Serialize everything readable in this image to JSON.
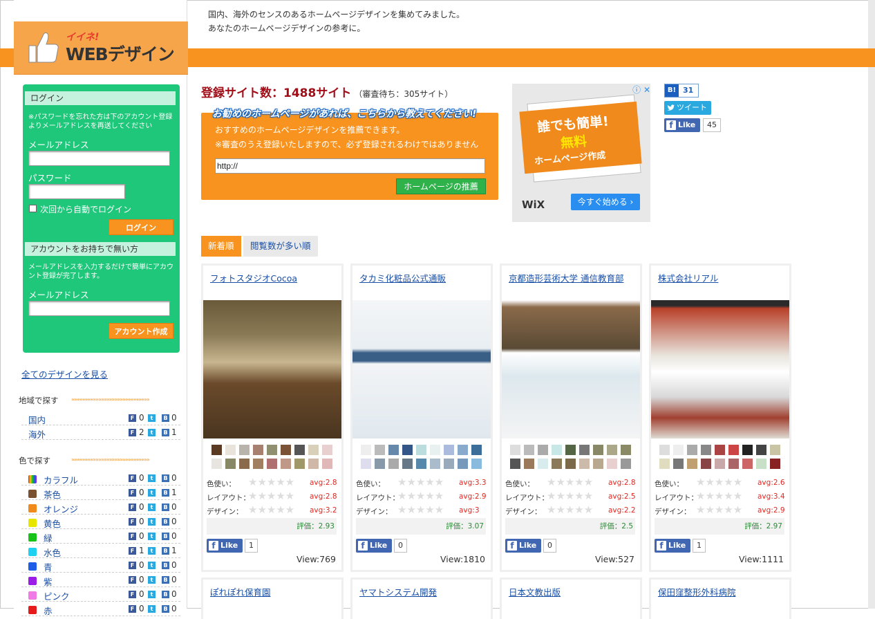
{
  "site": {
    "logo_small": "イイネ!",
    "logo_main": "WEBデザイン",
    "intro_line1": "国内、海外のセンスのあるホームページデザインを集めてみました。",
    "intro_line2": "あなたのホームページデザインの参考に。"
  },
  "login": {
    "title": "ログイン",
    "note": "※パスワードを忘れた方は下のアカウント登録よりメールアドレスを再送してください",
    "email_label": "メールアドレス",
    "password_label": "パスワード",
    "email_value": "",
    "password_value": "",
    "auto_login_label": "次回から自動でログイン",
    "login_button": "ログイン"
  },
  "signup": {
    "title": "アカウントをお持ちで無い方",
    "note": "メールアドレスを入力するだけで簡単にアカウント登録が完了します。",
    "email_label": "メールアドレス",
    "email_value": "",
    "create_button": "アカウント作成"
  },
  "sidebar": {
    "all_link": "全てのデザインを見る",
    "region_title": "地域で探す",
    "region_arrows": "»»»»»»»»»»»»»»»»»»»»»»»»»»»»»",
    "regions": [
      {
        "name": "国内",
        "f": "0",
        "t": "1",
        "b": "0"
      },
      {
        "name": "海外",
        "f": "2",
        "t": "1",
        "b": "1"
      }
    ],
    "color_title": "色で探す",
    "color_arrows": "»»»»»»»»»»»»»»»»»»»»»»»»»»»»»",
    "colors": [
      {
        "name": "カラフル",
        "swatch": "rainbow",
        "f": "0",
        "t": "1",
        "b": "0"
      },
      {
        "name": "茶色",
        "swatch": "#7a5230",
        "f": "0",
        "t": "1",
        "b": "1"
      },
      {
        "name": "オレンジ",
        "swatch": "#f08a1c",
        "f": "0",
        "t": "1",
        "b": "0"
      },
      {
        "name": "黄色",
        "swatch": "#e6e600",
        "f": "0",
        "t": "1",
        "b": "0"
      },
      {
        "name": "緑",
        "swatch": "#18c218",
        "f": "0",
        "t": "1",
        "b": "0"
      },
      {
        "name": "水色",
        "swatch": "#1fd1f0",
        "f": "1",
        "t": "1",
        "b": "1"
      },
      {
        "name": "青",
        "swatch": "#1c5fe6",
        "f": "0",
        "t": "1",
        "b": "0"
      },
      {
        "name": "紫",
        "swatch": "#9b1ce6",
        "f": "0",
        "t": "1",
        "b": "0"
      },
      {
        "name": "ピンク",
        "swatch": "#f07ae6",
        "f": "0",
        "t": "1",
        "b": "0"
      },
      {
        "name": "赤",
        "swatch": "#e61c1c",
        "f": "0",
        "t": "1",
        "b": "0"
      }
    ],
    "icon_f": "F",
    "icon_t": "t",
    "icon_b": "B"
  },
  "main": {
    "count_label": "登録サイト数：1488サイト",
    "count_sub": "（審査待ち：305サイト）",
    "recommend_head": "お勧めのホームページがあれば、こちらから教えてください!",
    "recommend_line1": "おすすめのホームページデザインを推薦できます。",
    "recommend_line2": "※審査のうえ登録いたしますので、必ず登録されるわけではありません",
    "url_value": "http://",
    "recommend_button": "ホームページの推薦"
  },
  "ad": {
    "info": "ⓘ ✕",
    "line1": "誰でも簡単!",
    "line2": "無料",
    "line3": "ホームページ作成",
    "brand": "WiX",
    "button": "今すぐ始める ›"
  },
  "share": {
    "hatena_label": "B!",
    "hatena_count": "31",
    "tweet_label": "ツイート",
    "like_label": "Like",
    "like_count": "45"
  },
  "tabs": [
    {
      "label": "新着順"
    },
    {
      "label": "閲覧数が多い順"
    }
  ],
  "rating_labels": {
    "color": "色使い：",
    "layout": "レイアウト：",
    "design": "デザイン："
  },
  "cards": [
    {
      "title": "フォトスタジオCocoa",
      "swatches": [
        "#5a3a22",
        "#e8e4dc",
        "#b8b4ac",
        "#a88070",
        "#909070",
        "#7a5236",
        "#555555",
        "#d8d0b8",
        "#e8d0d0",
        "#e8e4e0",
        "#888866",
        "#8a6a4a",
        "#a08060",
        "#b07070",
        "#c09888",
        "#a09868",
        "#d0b8a8",
        "#e0b8b8"
      ],
      "avg_color": "avg:2.8",
      "avg_layout": "avg:2.8",
      "avg_design": "avg:3.2",
      "score": "評価：2.93",
      "likes": "1",
      "views": "View:769"
    },
    {
      "title": "タカミ化粧品公式通販",
      "swatches": [
        "#eeeeee",
        "#bbbbbb",
        "#6688aa",
        "#335588",
        "#bbdddd",
        "#e8f0f0",
        "#aabbdd",
        "#88aacc",
        "#3b6f99",
        "#ddddee",
        "#8899aa",
        "#aaaaaa",
        "#667788",
        "#5588aa",
        "#aabbcc",
        "#99aabb",
        "#7799bb",
        "#88bbdd"
      ],
      "avg_color": "avg:3.3",
      "avg_layout": "avg:2.9",
      "avg_design": "avg:3",
      "score": "評価：3.07",
      "likes": "0",
      "views": "View:1810"
    },
    {
      "title": "京都造形芸術大学 通信教育部",
      "swatches": [
        "#dddddd",
        "#bbbbbb",
        "#aaaaaa",
        "#c8e8e8",
        "#556644",
        "#777777",
        "#888866",
        "#aaa888",
        "#8a8a66",
        "#555555",
        "#9a7a5a",
        "#d8ecee",
        "#8a7a5a",
        "#7a6a4a",
        "#ccbbaa",
        "#b8a890",
        "#e8d0d0",
        "#999999"
      ],
      "avg_color": "avg:2.8",
      "avg_layout": "avg:2.5",
      "avg_design": "avg:2.2",
      "score": "評価：2.5",
      "likes": "0",
      "views": "View:527"
    },
    {
      "title": "株式会社リアル",
      "swatches": [
        "#dddddd",
        "#eeeeee",
        "#aaaaaa",
        "#888888",
        "#aa4444",
        "#cc4444",
        "#222222",
        "#444444",
        "#c8c4a4",
        "#e0dcc0",
        "#777777",
        "#c0a070",
        "#884444",
        "#c8a8a8",
        "#aa6666",
        "#cc6666",
        "#c8e0c8",
        "#882222"
      ],
      "avg_color": "avg:2.6",
      "avg_layout": "avg:3.4",
      "avg_design": "avg:2.9",
      "score": "評価：2.97",
      "likes": "1",
      "views": "View:1111"
    }
  ],
  "next_cards": [
    {
      "title": "ぽれぽれ保育園"
    },
    {
      "title": "ヤマトシステム開発"
    },
    {
      "title": "日本文教出版"
    },
    {
      "title": "保田窪整形外科病院"
    }
  ],
  "stars": "★★★★★"
}
